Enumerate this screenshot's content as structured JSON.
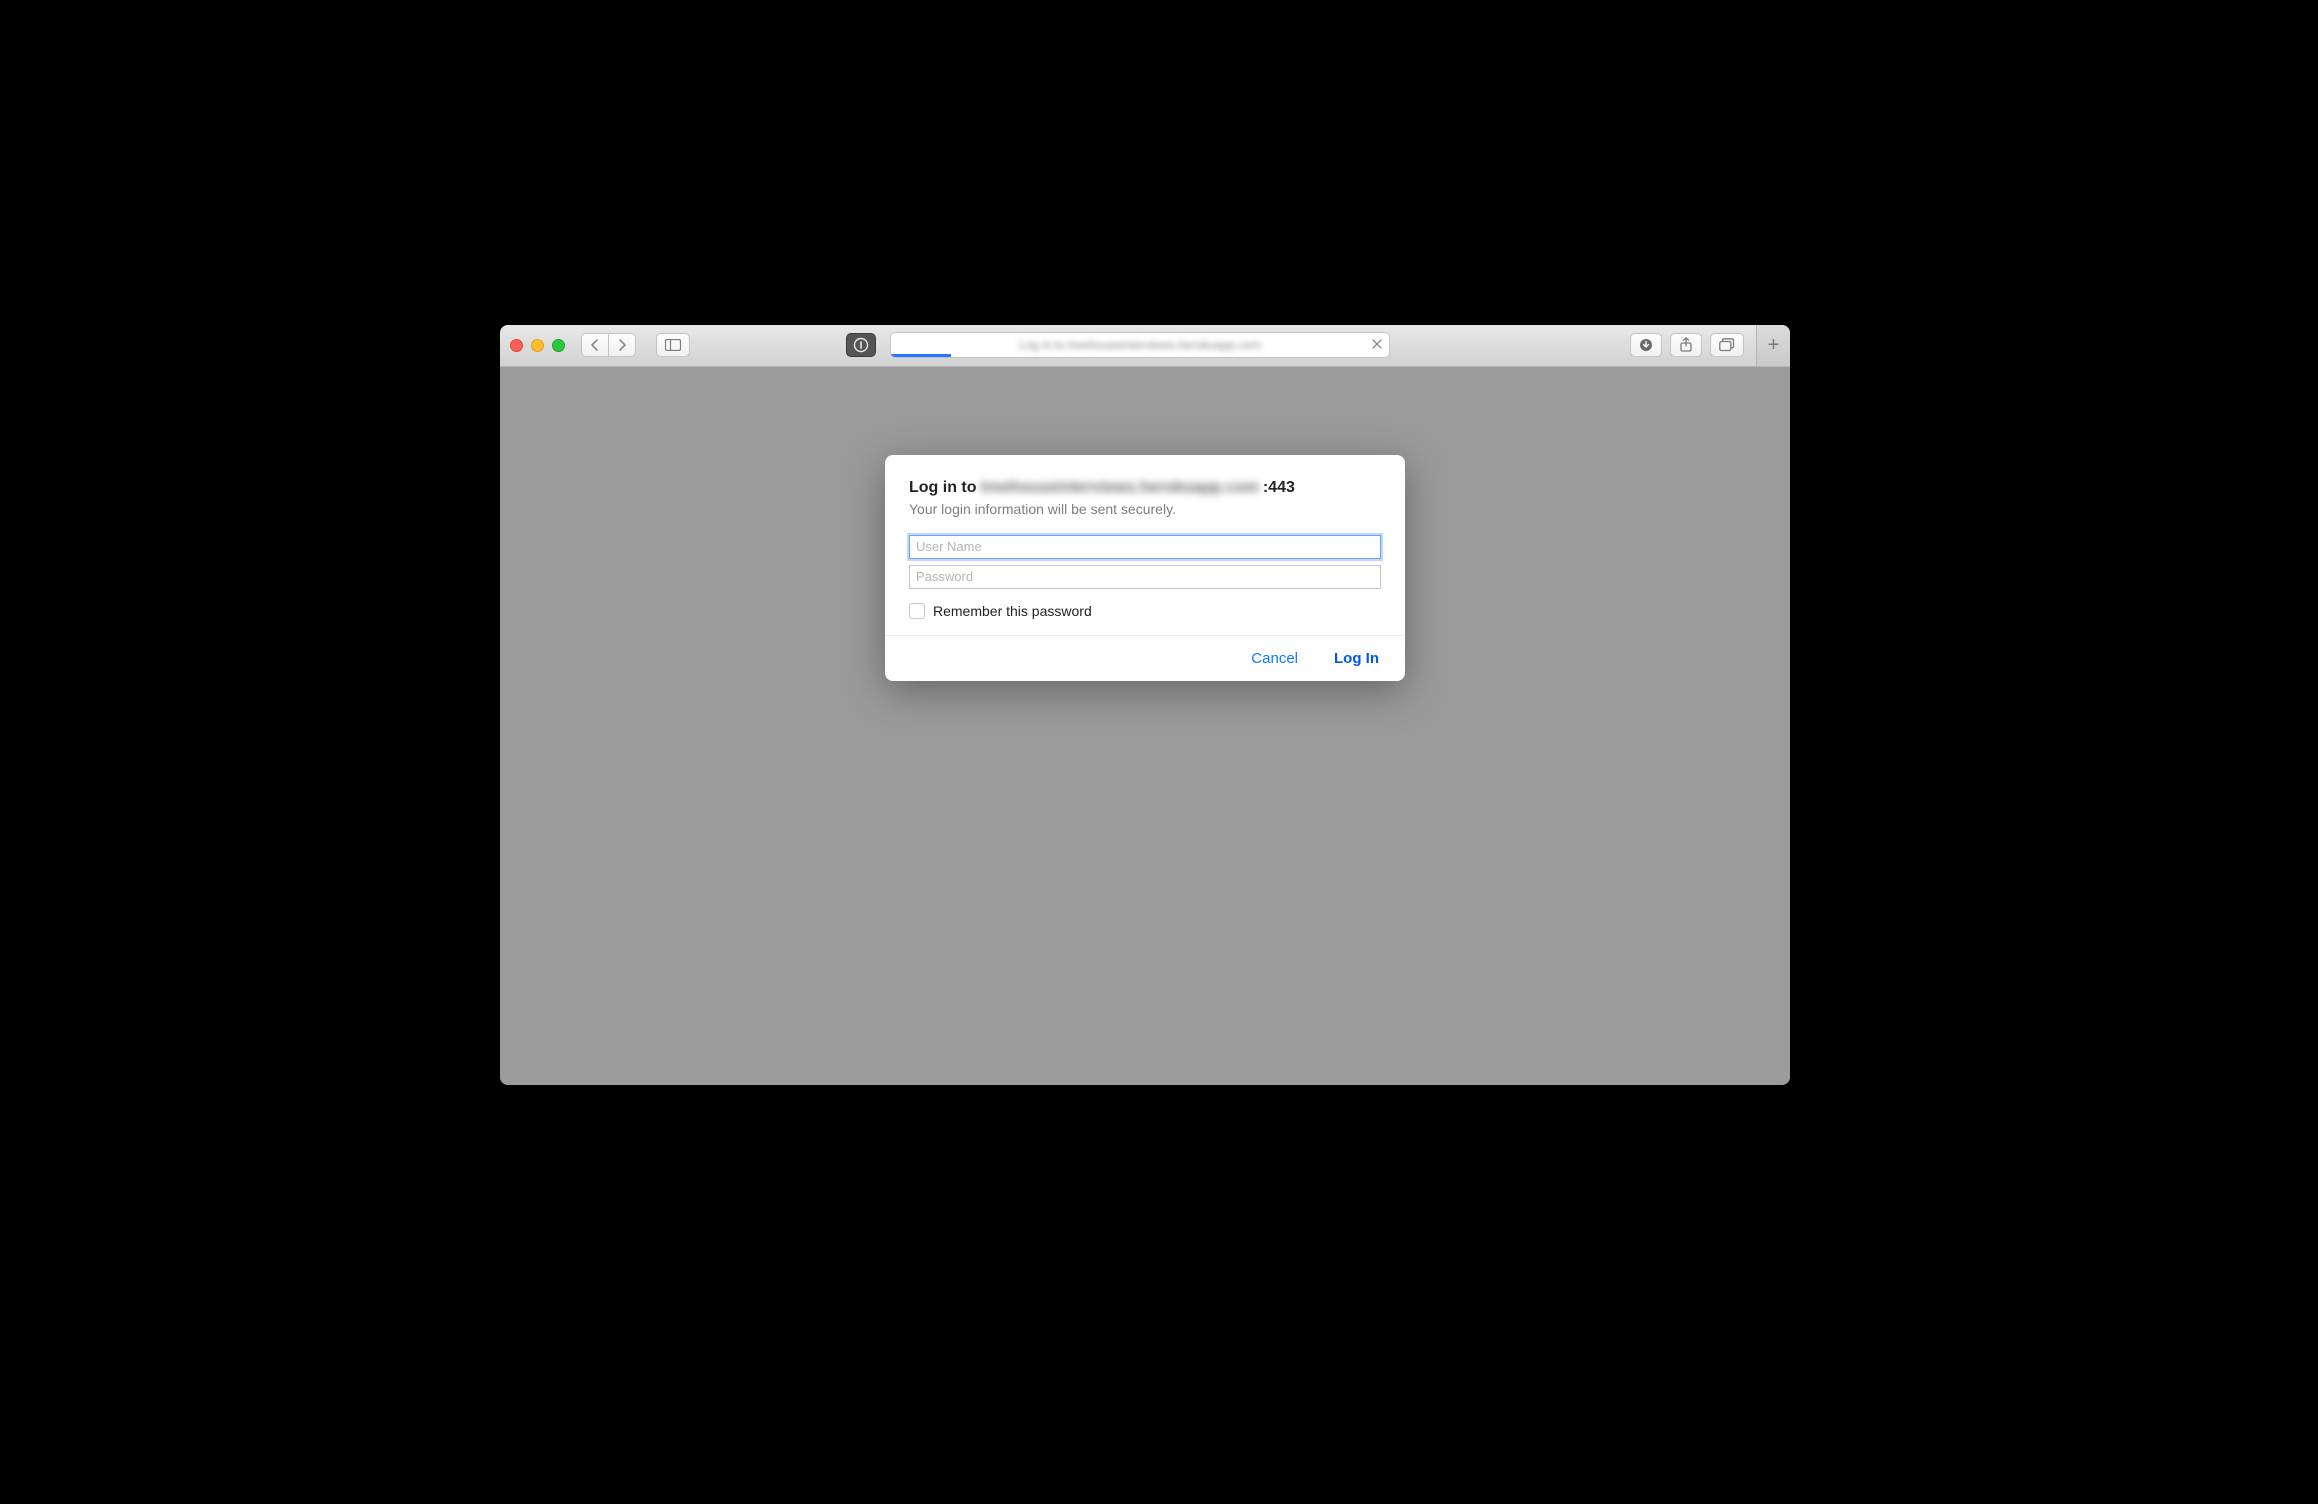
{
  "toolbar": {
    "url_display": "Log in to treehouseinterviews.herokuapp.com",
    "icons": {
      "back": "chevron-left",
      "forward": "chevron-right",
      "sidebar": "sidebar",
      "onepassword": "1password",
      "stop": "x",
      "downloads": "download",
      "share": "share",
      "tabs": "tabs",
      "newtab": "+"
    }
  },
  "dialog": {
    "title_prefix": "Log in to",
    "title_host_blurred": "treehouseinterviews.herokuapp.com",
    "title_suffix": ":443",
    "subtitle": "Your login information will be sent securely.",
    "username_placeholder": "User Name",
    "username_value": "",
    "password_placeholder": "Password",
    "password_value": "",
    "remember_label": "Remember this password",
    "cancel_label": "Cancel",
    "login_label": "Log In"
  }
}
